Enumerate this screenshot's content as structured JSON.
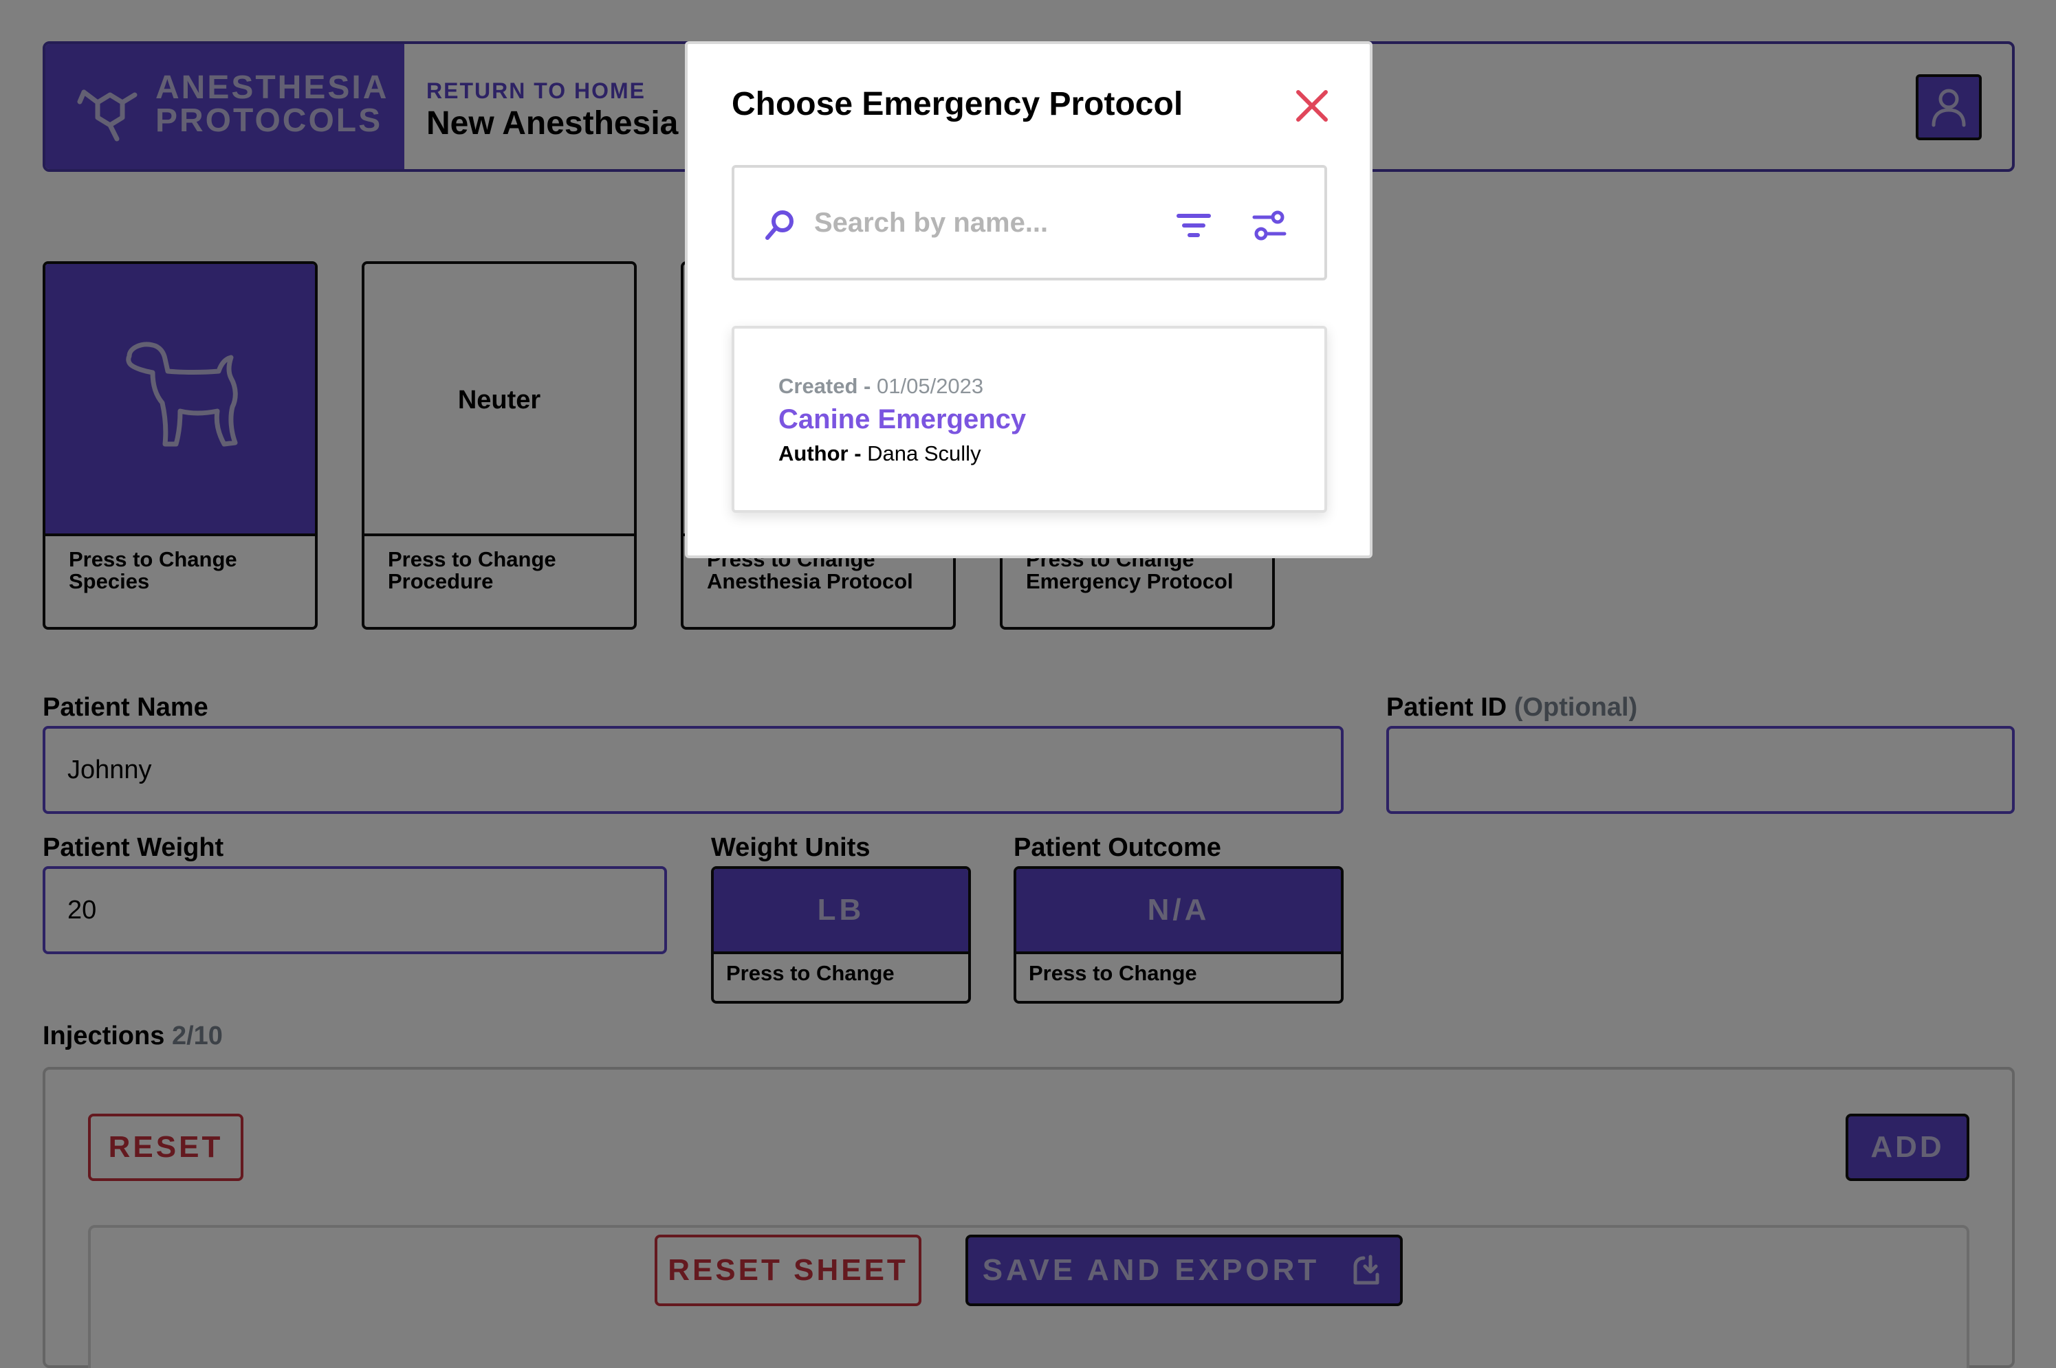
{
  "colors": {
    "brand": "#5a45c8",
    "danger": "#c8323e",
    "link": "#7b55e0",
    "overlay": "rgba(0,0,0,0.5)"
  },
  "header": {
    "brand_line1": "ANESTHESIA",
    "brand_line2": "PROTOCOLS",
    "return_home": "RETURN TO HOME",
    "sheet_title": "New Anesthesia Sheet",
    "profile_icon": "user-icon"
  },
  "cards": [
    {
      "top_icon": "dog-icon",
      "top_text": "",
      "label_line1": "Press to Change",
      "label_line2": "Species"
    },
    {
      "top_icon": "",
      "top_text": "Neuter",
      "label_line1": "Press to Change",
      "label_line2": "Procedure"
    },
    {
      "top_icon": "",
      "top_text": "",
      "label_line1": "Press to Change",
      "label_line2": "Anesthesia Protocol"
    },
    {
      "top_icon": "",
      "top_text": "",
      "label_line1": "Press to Change",
      "label_line2": "Emergency Protocol"
    }
  ],
  "form": {
    "patient_name_label": "Patient Name",
    "patient_name_value": "Johnny",
    "patient_id_label": "Patient ID",
    "patient_id_optional": "(Optional)",
    "patient_id_value": "",
    "patient_weight_label": "Patient Weight",
    "patient_weight_value": "20",
    "weight_units_label": "Weight Units",
    "weight_units_value": "LB",
    "weight_units_hint": "Press to Change",
    "outcome_label": "Patient Outcome",
    "outcome_value": "N/A",
    "outcome_hint": "Press to Change"
  },
  "injections": {
    "label": "Injections",
    "count": "2/10",
    "reset_label": "RESET",
    "add_label": "ADD"
  },
  "footer": {
    "reset_sheet_label": "RESET SHEET",
    "save_export_label": "SAVE AND EXPORT",
    "save_icon": "export-icon"
  },
  "modal": {
    "title": "Choose Emergency Protocol",
    "close_icon": "close-icon",
    "search_placeholder": "Search by name...",
    "search_value": "",
    "results": [
      {
        "created_label": "Created -",
        "created_date": "01/05/2023",
        "name": "Canine Emergency",
        "author_label": "Author -",
        "author_name": "Dana Scully"
      }
    ]
  }
}
